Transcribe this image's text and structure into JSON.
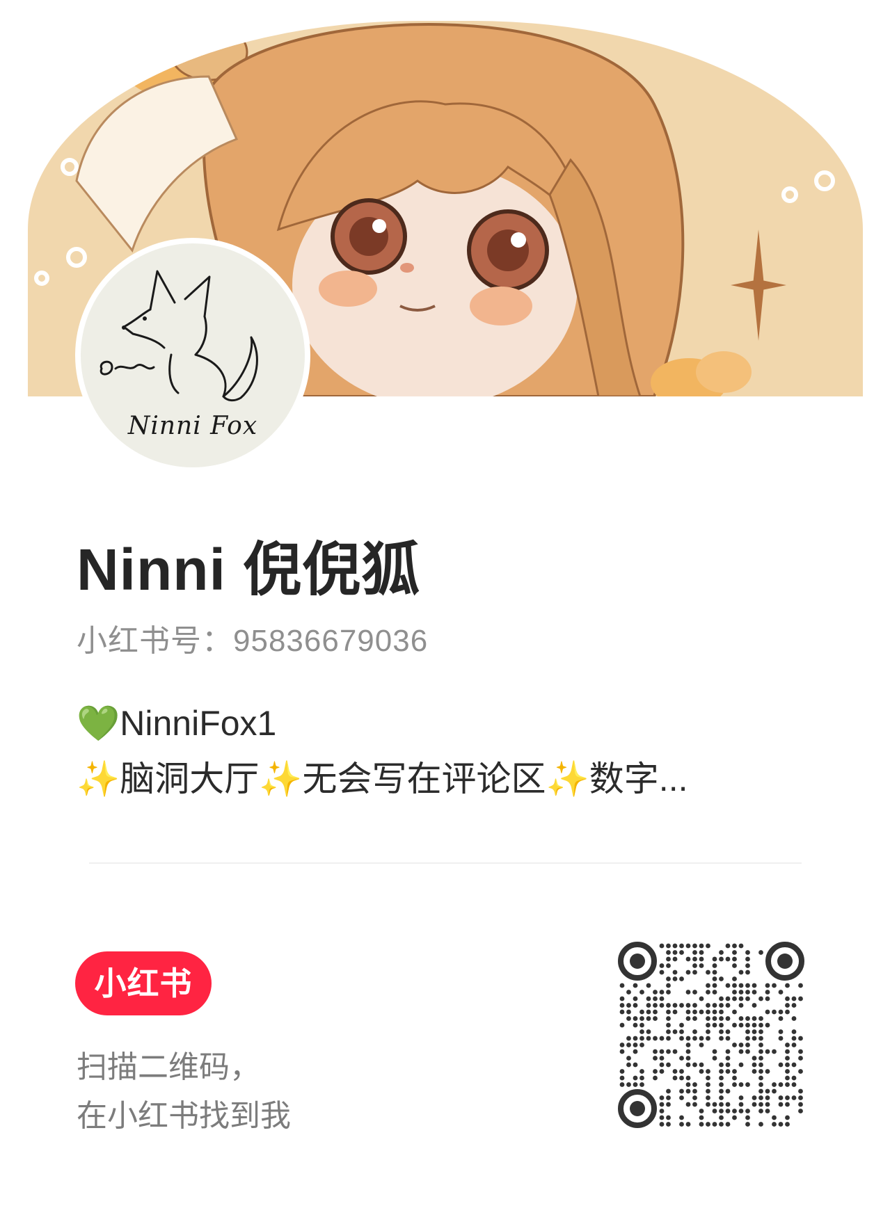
{
  "profile": {
    "name": "Ninni 倪倪狐",
    "id_label": "小红书号：",
    "id_value": "95836679036",
    "avatar_caption": "Ninni Fox",
    "bio_line1_heart": "💚",
    "bio_line1_text": "NinniFox1",
    "bio_line2": [
      {
        "kind": "sparkle",
        "text": "✨"
      },
      {
        "kind": "text",
        "text": "脑洞大厅"
      },
      {
        "kind": "sparkle",
        "text": "✨"
      },
      {
        "kind": "text",
        "text": "无会写在评论区"
      },
      {
        "kind": "sparkle",
        "text": "✨"
      },
      {
        "kind": "text",
        "text": "数字..."
      }
    ]
  },
  "footer": {
    "brand_label": "小红书",
    "scan_line1": "扫描二维码，",
    "scan_line2": "在小红书找到我"
  },
  "icons": {
    "banner": "anime-girl-illustration",
    "avatar": "fox-sketch-icon",
    "qr": "qr-code-icon"
  },
  "colors": {
    "brand_red": "#ff2442",
    "banner_bg": "#f1d7ad",
    "text_dark": "#262626",
    "text_gray": "#8f8f8f"
  }
}
